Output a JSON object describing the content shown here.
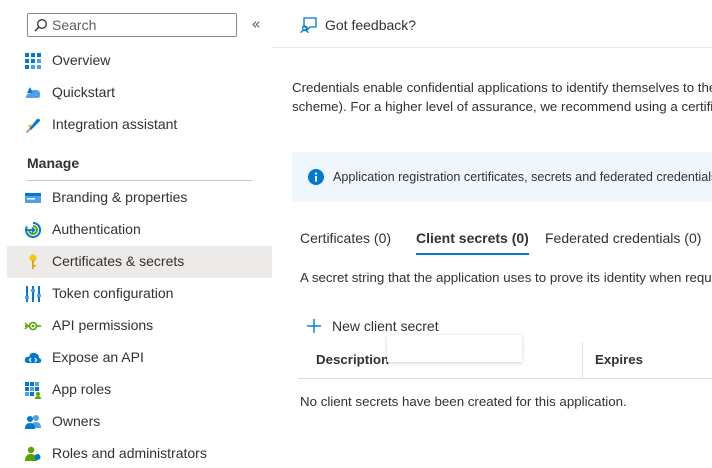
{
  "search": {
    "placeholder": "Search"
  },
  "sidebar": {
    "collapse_glyph": "«",
    "items_top": [
      {
        "label": "Overview",
        "icon": "overview-icon"
      },
      {
        "label": "Quickstart",
        "icon": "quickstart-icon"
      },
      {
        "label": "Integration assistant",
        "icon": "rocket-icon"
      }
    ],
    "section_title": "Manage",
    "items_manage": [
      {
        "label": "Branding & properties",
        "icon": "branding-icon"
      },
      {
        "label": "Authentication",
        "icon": "authentication-icon"
      },
      {
        "label": "Certificates & secrets",
        "icon": "key-icon",
        "selected": true
      },
      {
        "label": "Token configuration",
        "icon": "token-icon"
      },
      {
        "label": "API permissions",
        "icon": "api-permissions-icon"
      },
      {
        "label": "Expose an API",
        "icon": "cloud-icon"
      },
      {
        "label": "App roles",
        "icon": "app-roles-icon"
      },
      {
        "label": "Owners",
        "icon": "owners-icon"
      },
      {
        "label": "Roles and administrators",
        "icon": "roles-icon"
      }
    ]
  },
  "header": {
    "feedback_label": "Got feedback?"
  },
  "main": {
    "description_line1": "Credentials enable confidential applications to identify themselves to the",
    "description_line2": "scheme). For a higher level of assurance, we recommend using a certificat",
    "info_text": "Application registration certificates, secrets and federated credentials ca",
    "tabs": [
      {
        "label": "Certificates (0)"
      },
      {
        "label": "Client secrets (0)",
        "active": true
      },
      {
        "label": "Federated credentials (0)"
      }
    ],
    "tab_description": "A secret string that the application uses to prove its identity when reque",
    "new_secret_label": "New client secret",
    "table": {
      "columns": [
        "Description",
        "Expires"
      ],
      "empty_message": "No client secrets have been created for this application."
    }
  },
  "colors": {
    "accent": "#0078d4",
    "selected_bg": "#edebe9",
    "info_bg": "#eff6fc"
  }
}
